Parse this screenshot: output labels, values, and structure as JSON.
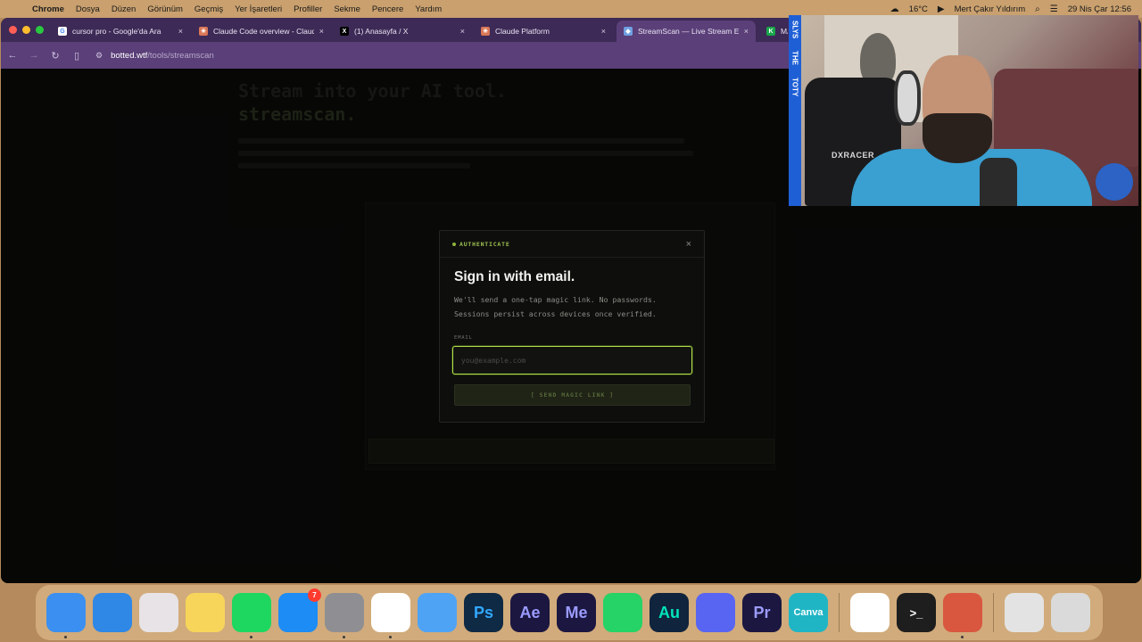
{
  "menubar": {
    "app": "Chrome",
    "menus": [
      "Dosya",
      "Düzen",
      "Görünüm",
      "Geçmiş",
      "Yer İşaretleri",
      "Profiller",
      "Sekme",
      "Pencere",
      "Yardım"
    ],
    "weather": "16°C",
    "user": "Mert Çakır Yıldırım",
    "datetime": "29 Nis Çar  12:56"
  },
  "tabs": [
    {
      "title": "cursor pro - Google'da Ara",
      "favicon": "google-icon",
      "close": "×"
    },
    {
      "title": "Claude Code overview - Claude",
      "favicon": "claude-icon",
      "close": "×"
    },
    {
      "title": "(1) Anasayfa / X",
      "favicon": "x-icon",
      "close": "×"
    },
    {
      "title": "Claude Platform",
      "favicon": "claude-icon",
      "close": "×"
    },
    {
      "title": "StreamScan — Live Stream En",
      "favicon": "streamscan-icon",
      "close": "×"
    },
    {
      "title": "MA",
      "favicon": "k-icon"
    }
  ],
  "url": {
    "host": "botted.wtf",
    "path": "/tools/streamscan"
  },
  "background": {
    "title_line1": "Stream into your AI tool.",
    "title_line2": "streamscan."
  },
  "modal": {
    "kicker": "AUTHENTICATE",
    "close": "×",
    "heading": "Sign in with email.",
    "desc_line1": "We'll send a one-tap magic link. No passwords.",
    "desc_line2": "Sessions persist across devices once verified.",
    "email_label": "EMAIL",
    "email_placeholder": "you@example.com",
    "email_value": "",
    "button": "[ SEND MAGIC LINK ]"
  },
  "webcam": {
    "rail_labels": [
      "SLYS",
      "THE",
      "TOTY"
    ],
    "chair_brand": "DXRACER"
  },
  "dock": [
    {
      "name": "finder",
      "label": "",
      "color": "#3b8ff0"
    },
    {
      "name": "safari",
      "label": "",
      "color": "#2f87e6"
    },
    {
      "name": "launchpad",
      "label": "",
      "color": "#e7e3e6"
    },
    {
      "name": "notes",
      "label": "",
      "color": "#f7d55a"
    },
    {
      "name": "spotify",
      "label": "",
      "color": "#1ed760"
    },
    {
      "name": "app-store",
      "label": "",
      "color": "#1d8cf5",
      "badge": "7"
    },
    {
      "name": "system-settings",
      "label": "",
      "color": "#8f8f93"
    },
    {
      "name": "chrome",
      "label": "",
      "color": "#ffffff"
    },
    {
      "name": "mail",
      "label": "",
      "color": "#4fa3f5"
    },
    {
      "name": "photoshop",
      "label": "Ps",
      "color": "#0f2a44"
    },
    {
      "name": "after-effects",
      "label": "Ae",
      "color": "#1b1740"
    },
    {
      "name": "media-encoder",
      "label": "Me",
      "color": "#1b1740"
    },
    {
      "name": "whatsapp",
      "label": "",
      "color": "#25d366"
    },
    {
      "name": "audition",
      "label": "Au",
      "color": "#10243d"
    },
    {
      "name": "discord",
      "label": "",
      "color": "#5865f2"
    },
    {
      "name": "premiere",
      "label": "Pr",
      "color": "#1b1740"
    },
    {
      "name": "canva",
      "label": "Canva",
      "color": "#1fb5c5"
    },
    {
      "name": "chrome-2",
      "label": "",
      "color": "#ffffff"
    },
    {
      "name": "terminal",
      "label": ">_",
      "color": "#1e1e1e"
    },
    {
      "name": "claude",
      "label": "",
      "color": "#d9573f"
    },
    {
      "name": "downloads",
      "label": "",
      "color": "#e3e3e3"
    },
    {
      "name": "trash",
      "label": "",
      "color": "#dadada"
    }
  ]
}
